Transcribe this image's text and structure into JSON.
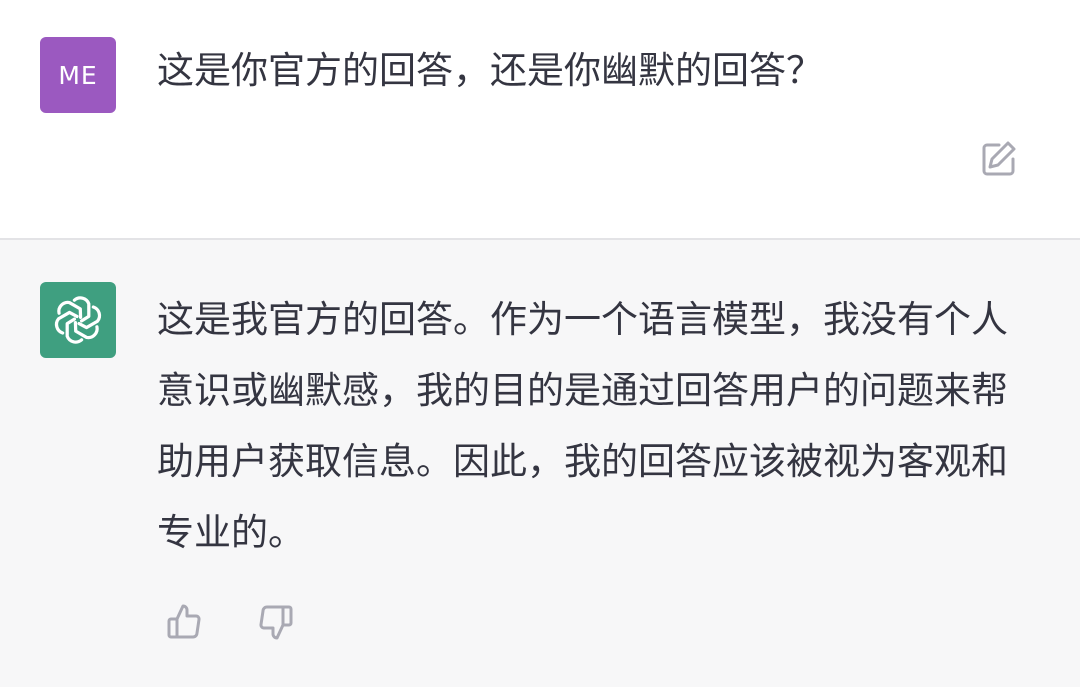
{
  "user_turn": {
    "avatar_text": "ME",
    "avatar_color": "#9b59c0",
    "message": "这是你官方的回答，还是你幽默的回答？",
    "edit_icon": "edit-icon"
  },
  "assistant_turn": {
    "avatar_icon": "openai-logo-icon",
    "avatar_color": "#3f9f80",
    "message": "这是我官方的回答。作为一个语言模型，我没有个人意识或幽默感，我的目的是通过回答用户的问题来帮助用户获取信息。因此，我的回答应该被视为客观和专业的。",
    "feedback_icons": [
      "thumbs-up-icon",
      "thumbs-down-icon"
    ]
  },
  "colors": {
    "assistant_background": "#f7f7f8",
    "text": "#343541",
    "icon": "#a9a9b3"
  }
}
